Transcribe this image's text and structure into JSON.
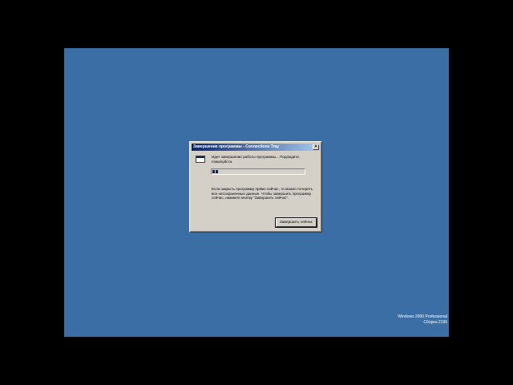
{
  "dialog": {
    "title": "Завершение программы - Connections Tray",
    "close_glyph": "×",
    "message": "Идет завершение работы программы... Подождите, пожалуйста.",
    "progress_fraction": 0.08,
    "warning": "Если закрыть программу прямо сейчас, то можно потерять все несохраненные данные. Чтобы завершить программу сейчас, нажмите кнопку \"Завершить сейчас\".",
    "end_now_label": "Завершить сейчас"
  },
  "desktop": {
    "os_name": "Windows 2000 Professional",
    "build": "Сборка 2195"
  },
  "colors": {
    "desktop": "#3a6ea5",
    "titlebar_start": "#0a246a",
    "titlebar_end": "#a6caf0",
    "face": "#d4d0c8"
  },
  "icons": {
    "app": "window-app-icon",
    "close": "close-icon"
  }
}
